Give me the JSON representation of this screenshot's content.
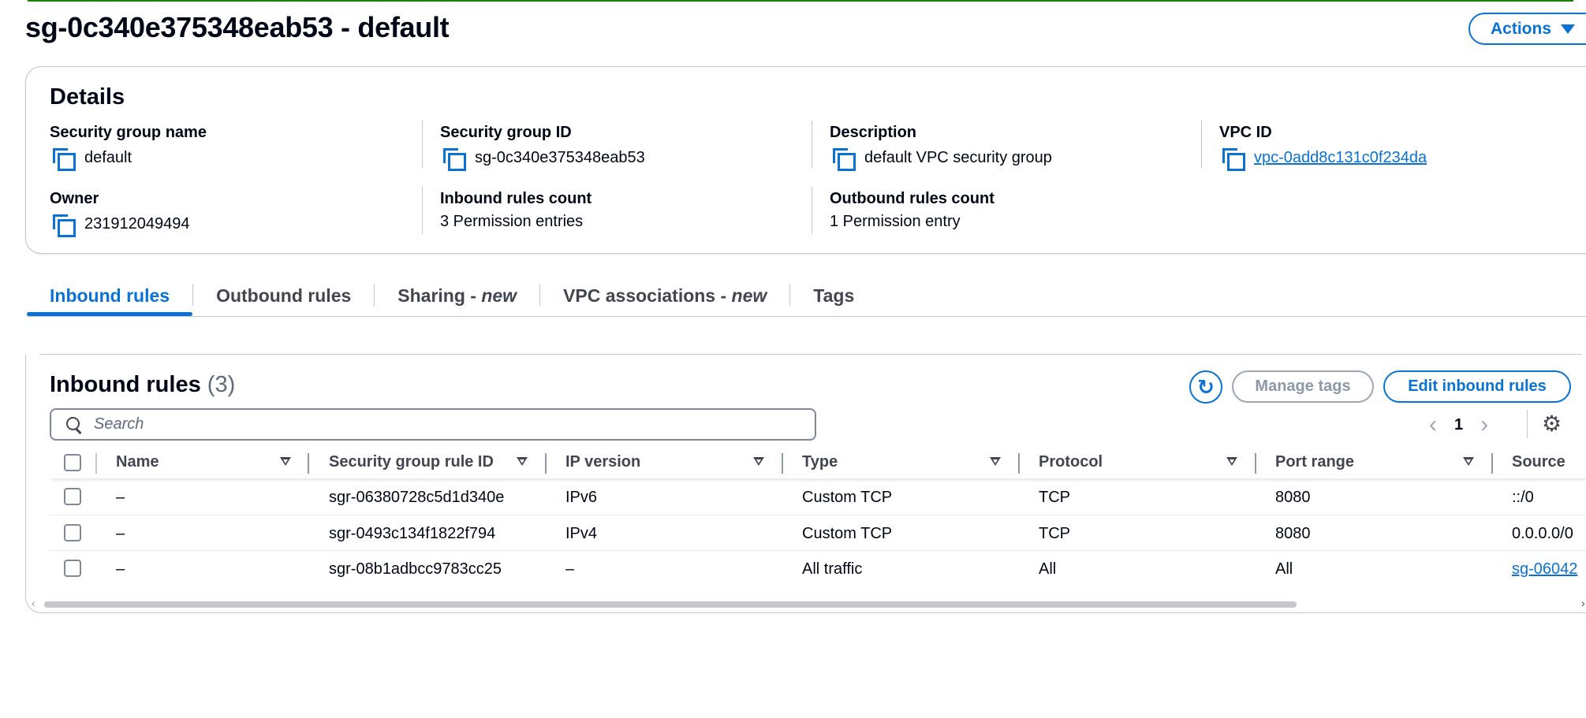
{
  "page": {
    "title": "sg-0c340e375348eab53 - default",
    "actions_label": "Actions"
  },
  "details": {
    "title": "Details",
    "security_group_name": {
      "label": "Security group name",
      "value": "default"
    },
    "security_group_id": {
      "label": "Security group ID",
      "value": "sg-0c340e375348eab53"
    },
    "description": {
      "label": "Description",
      "value": "default VPC security group"
    },
    "vpc_id": {
      "label": "VPC ID",
      "value": "vpc-0add8c131c0f234da"
    },
    "owner": {
      "label": "Owner",
      "value": "231912049494"
    },
    "inbound_rules_count": {
      "label": "Inbound rules count",
      "value": "3 Permission entries"
    },
    "outbound_rules_count": {
      "label": "Outbound rules count",
      "value": "1 Permission entry"
    }
  },
  "tabs": [
    {
      "label": "Inbound rules",
      "suffix": ""
    },
    {
      "label": "Outbound rules",
      "suffix": ""
    },
    {
      "label": "Sharing - ",
      "suffix": "new"
    },
    {
      "label": "VPC associations - ",
      "suffix": "new"
    },
    {
      "label": "Tags",
      "suffix": ""
    }
  ],
  "inbound": {
    "title": "Inbound rules",
    "count": "(3)",
    "manage_tags_label": "Manage tags",
    "edit_label": "Edit inbound rules",
    "search_placeholder": "Search",
    "page_number": "1",
    "columns": [
      "Name",
      "Security group rule ID",
      "IP version",
      "Type",
      "Protocol",
      "Port range",
      "Source"
    ],
    "rows": [
      {
        "name": "–",
        "rule_id": "sgr-06380728c5d1d340e",
        "ip_version": "IPv6",
        "type": "Custom TCP",
        "protocol": "TCP",
        "port_range": "8080",
        "source": "::/0"
      },
      {
        "name": "–",
        "rule_id": "sgr-0493c134f1822f794",
        "ip_version": "IPv4",
        "type": "Custom TCP",
        "protocol": "TCP",
        "port_range": "8080",
        "source": "0.0.0.0/0"
      },
      {
        "name": "–",
        "rule_id": "sgr-08b1adbcc9783cc25",
        "ip_version": "–",
        "type": "All traffic",
        "protocol": "All",
        "port_range": "All",
        "source": "sg-06042"
      }
    ]
  },
  "colors": {
    "accent": "#0972d3",
    "success_bar": "#1d8102",
    "border": "#c6c6cd",
    "text": "#000716"
  },
  "icons": {
    "copy": "copy-icon",
    "search": "search-icon",
    "refresh": "refresh-icon",
    "settings": "gear-icon",
    "sort": "sort-icon",
    "dropdown": "caret-down-icon"
  }
}
